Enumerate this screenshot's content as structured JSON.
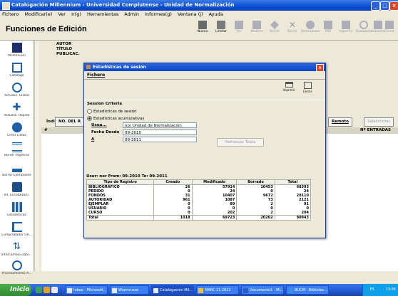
{
  "window": {
    "title": "Catalogación Millennium - Universidad Complutense - Unidad de Normalización",
    "controls": [
      "_",
      "□",
      "×"
    ]
  },
  "menubar": [
    "Fichero",
    "Modificar(e)",
    "Ver",
    "Ir(g)",
    "Herramientas",
    "Admin",
    "Informes(g)",
    "Ventana (j)",
    "Ayuda"
  ],
  "header": {
    "title": "Funciones de Edición",
    "toolbar": [
      {
        "label": "Nuevo",
        "icon": "new-record-icon",
        "enabled": true
      },
      {
        "label": "Limitar",
        "icon": "limit-icon",
        "enabled": true
      },
      {
        "label": "Ver",
        "icon": "view-icon",
        "enabled": false
      },
      {
        "label": "Mostrar",
        "icon": "show-icon",
        "enabled": false
      },
      {
        "label": "Borrar",
        "icon": "delete-icon",
        "enabled": false
      },
      {
        "label": "Borrar",
        "icon": "clear-icon",
        "enabled": false
      },
      {
        "label": "Reemplazar",
        "icon": "replace-icon",
        "enabled": false
      },
      {
        "label": "MBI",
        "icon": "mbi-icon",
        "enabled": false
      },
      {
        "label": "Imprimir",
        "icon": "print-icon",
        "enabled": false
      },
      {
        "label": "Búsqueda",
        "icon": "search-icon",
        "enabled": false
      },
      {
        "label": "Importar",
        "icon": "import-icon",
        "enabled": false
      },
      {
        "label": "Cerrar",
        "icon": "close-icon",
        "enabled": false
      }
    ]
  },
  "sidebar": [
    {
      "label": "Millennium",
      "icon": "millennium-logo-icon"
    },
    {
      "label": "Catálogo",
      "icon": "catalog-icon"
    },
    {
      "label": "Actualiz. Global",
      "icon": "global-update-icon"
    },
    {
      "label": "Actualiz. Rápida",
      "icon": "rapid-update-icon"
    },
    {
      "label": "Crear Listas",
      "icon": "create-lists-icon"
    },
    {
      "label": "Borrar registros",
      "icon": "delete-records-icon"
    },
    {
      "label": "Borrar Ejemplares",
      "icon": "delete-items-icon"
    },
    {
      "label": "Inf. Encabezam.",
      "icon": "headings-report-icon"
    },
    {
      "label": "Estadísticas",
      "icon": "statistics-icon"
    },
    {
      "label": "Comprobador UR...",
      "icon": "url-checker-icon"
    },
    {
      "label": "Intercambio Dato...",
      "icon": "data-exchange-icon"
    },
    {
      "label": "Procesamiento A...",
      "icon": "processing-icon"
    }
  ],
  "content": {
    "fields": [
      "AUTOR",
      "TÍTULO",
      "PUBLICAC."
    ],
    "index_label": "Índice",
    "index_value": "NO. DEL R",
    "remote_button": "Remoto",
    "select_button": "Seleccionar",
    "col_hash": "#",
    "col_entries": "Nº ENTRADAS"
  },
  "dialog": {
    "title": "Estadísticas de sesión",
    "menu": "Fichero",
    "print_label": "Imprimir",
    "close_label": "Cerrar",
    "criteria_title": "Session Criteria",
    "radio_session": "Estadísticas de sesión",
    "radio_cumulative": "Estadísticas acumulativas",
    "cumulative_selected": true,
    "user_label": "Usua...",
    "user_value": "nor Unidad de Normalización",
    "date_from_label": "Fecha Desde",
    "date_from_value": "09-2010",
    "date_to_label": "A",
    "date_to_value": "09-2011",
    "refresh_button": "Refrescar Tabla",
    "period_text": "User: nor From: 09-2010 To: 09-2011",
    "table": {
      "headers": [
        "Tipo de Registro",
        "Creado",
        "Modificado",
        "Borrado",
        "Total"
      ],
      "rows": [
        [
          "BIBLIOGRAFICO",
          "26",
          "57914",
          "10453",
          "68393"
        ],
        [
          "PEDIDO",
          "0",
          "24",
          "0",
          "24"
        ],
        [
          "FONDOS",
          "31",
          "10407",
          "9672",
          "20110"
        ],
        [
          "AUTORIDAD",
          "961",
          "1087",
          "73",
          "2121"
        ],
        [
          "EJEMPLAR",
          "0",
          "89",
          "2",
          "91"
        ],
        [
          "USUARIO",
          "0",
          "0",
          "0",
          "0"
        ],
        [
          "CURSO",
          "0",
          "202",
          "2",
          "204"
        ]
      ],
      "total": [
        "Total",
        "1018",
        "69723",
        "20202",
        "90943"
      ]
    }
  },
  "taskbar": {
    "start": "Inicio",
    "tasks": [
      "Inbox - Microsoft...",
      "Wunmr.exe",
      "Catalogación Mil...",
      "MARC 21 2011",
      "Documento1 - Mi...",
      "BUCM - Bibliotec..."
    ],
    "tray_text": "ES",
    "clock": "13:06"
  }
}
